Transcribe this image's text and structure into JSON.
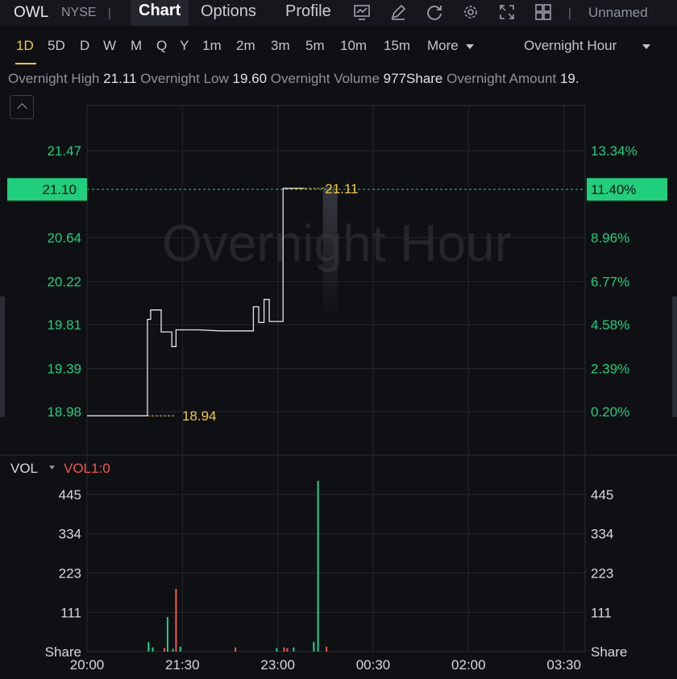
{
  "header": {
    "symbol": "OWL",
    "exchange": "NYSE",
    "tabs": [
      "Chart",
      "Options",
      "Profile"
    ],
    "active_tab": "Chart",
    "layout_name": "Unnamed"
  },
  "toolbar_icons": [
    "chart-icon",
    "draw-icon",
    "refresh-icon",
    "settings-icon",
    "fullscreen-icon",
    "layout-grid-icon"
  ],
  "periods": {
    "items": [
      "1D",
      "5D",
      "D",
      "W",
      "M",
      "Q",
      "Y",
      "1m",
      "2m",
      "3m",
      "5m",
      "10m",
      "15m",
      "More"
    ],
    "active": "1D",
    "session": "Overnight Hour"
  },
  "info_bar": {
    "high_label": "Overnight High",
    "high": "21.11",
    "low_label": "Overnight Low",
    "low": "19.60",
    "volume_label": "Overnight Volume",
    "volume": "977Share",
    "amount_label": "Overnight Amount",
    "amount": "19."
  },
  "chart_data": {
    "type": "line",
    "watermark": "Overnight Hour",
    "price_axis": [
      "21.47",
      "20.64",
      "20.22",
      "19.81",
      "19.39",
      "18.98"
    ],
    "percent_axis": [
      "13.34%",
      "8.96%",
      "6.77%",
      "4.58%",
      "2.39%",
      "0.20%"
    ],
    "current_price": "21.10",
    "current_percent": "11.40%",
    "high_marker": "21.11",
    "low_marker": "18.94",
    "ylim": [
      18.94,
      21.47
    ],
    "time_labels": [
      "20:00",
      "21:30",
      "23:00",
      "00:30",
      "02:00",
      "03:30"
    ],
    "time_start": "20:00",
    "series": [
      {
        "values": [
          [
            "20:00",
            18.94
          ],
          [
            "20:57",
            18.94
          ],
          [
            "20:57",
            19.86
          ],
          [
            "21:00",
            19.86
          ],
          [
            "21:00",
            19.95
          ],
          [
            "21:10",
            19.95
          ],
          [
            "21:10",
            19.74
          ],
          [
            "21:20",
            19.74
          ],
          [
            "21:20",
            19.6
          ],
          [
            "21:24",
            19.6
          ],
          [
            "21:24",
            19.76
          ],
          [
            "21:45",
            19.76
          ],
          [
            "22:05",
            19.75
          ],
          [
            "22:37",
            19.75
          ],
          [
            "22:37",
            19.98
          ],
          [
            "22:42",
            19.98
          ],
          [
            "22:42",
            19.83
          ],
          [
            "22:47",
            19.83
          ],
          [
            "22:47",
            20.05
          ],
          [
            "22:52",
            20.05
          ],
          [
            "22:52",
            19.84
          ],
          [
            "23:00",
            19.84
          ],
          [
            "23:05",
            19.84
          ],
          [
            "23:05",
            21.11
          ],
          [
            "23:25",
            21.11
          ]
        ]
      }
    ]
  },
  "volume": {
    "label": "VOL",
    "indicator": "VOL1:0",
    "axis": [
      "445",
      "334",
      "223",
      "111"
    ],
    "unit": "Share",
    "ylim": [
      0,
      520
    ],
    "bars": [
      {
        "t": "20:58",
        "v": 27,
        "dir": "up"
      },
      {
        "t": "21:02",
        "v": 12,
        "dir": "up"
      },
      {
        "t": "21:13",
        "v": 10,
        "dir": "down"
      },
      {
        "t": "21:16",
        "v": 98,
        "dir": "up"
      },
      {
        "t": "21:21",
        "v": 8,
        "dir": "up"
      },
      {
        "t": "21:24",
        "v": 178,
        "dir": "down"
      },
      {
        "t": "21:28",
        "v": 14,
        "dir": "up"
      },
      {
        "t": "22:20",
        "v": 12,
        "dir": "down"
      },
      {
        "t": "22:59",
        "v": 10,
        "dir": "up"
      },
      {
        "t": "23:06",
        "v": 12,
        "dir": "down"
      },
      {
        "t": "23:09",
        "v": 10,
        "dir": "down"
      },
      {
        "t": "23:15",
        "v": 12,
        "dir": "up"
      },
      {
        "t": "23:34",
        "v": 28,
        "dir": "up"
      },
      {
        "t": "23:38",
        "v": 484,
        "dir": "up"
      },
      {
        "t": "23:46",
        "v": 14,
        "dir": "down"
      }
    ]
  },
  "colors": {
    "up": "#1fd18a",
    "down": "#f2584e",
    "accent": "#f0c93a",
    "price_tag": "#1fcf7c",
    "line": "#e4e6ea"
  }
}
